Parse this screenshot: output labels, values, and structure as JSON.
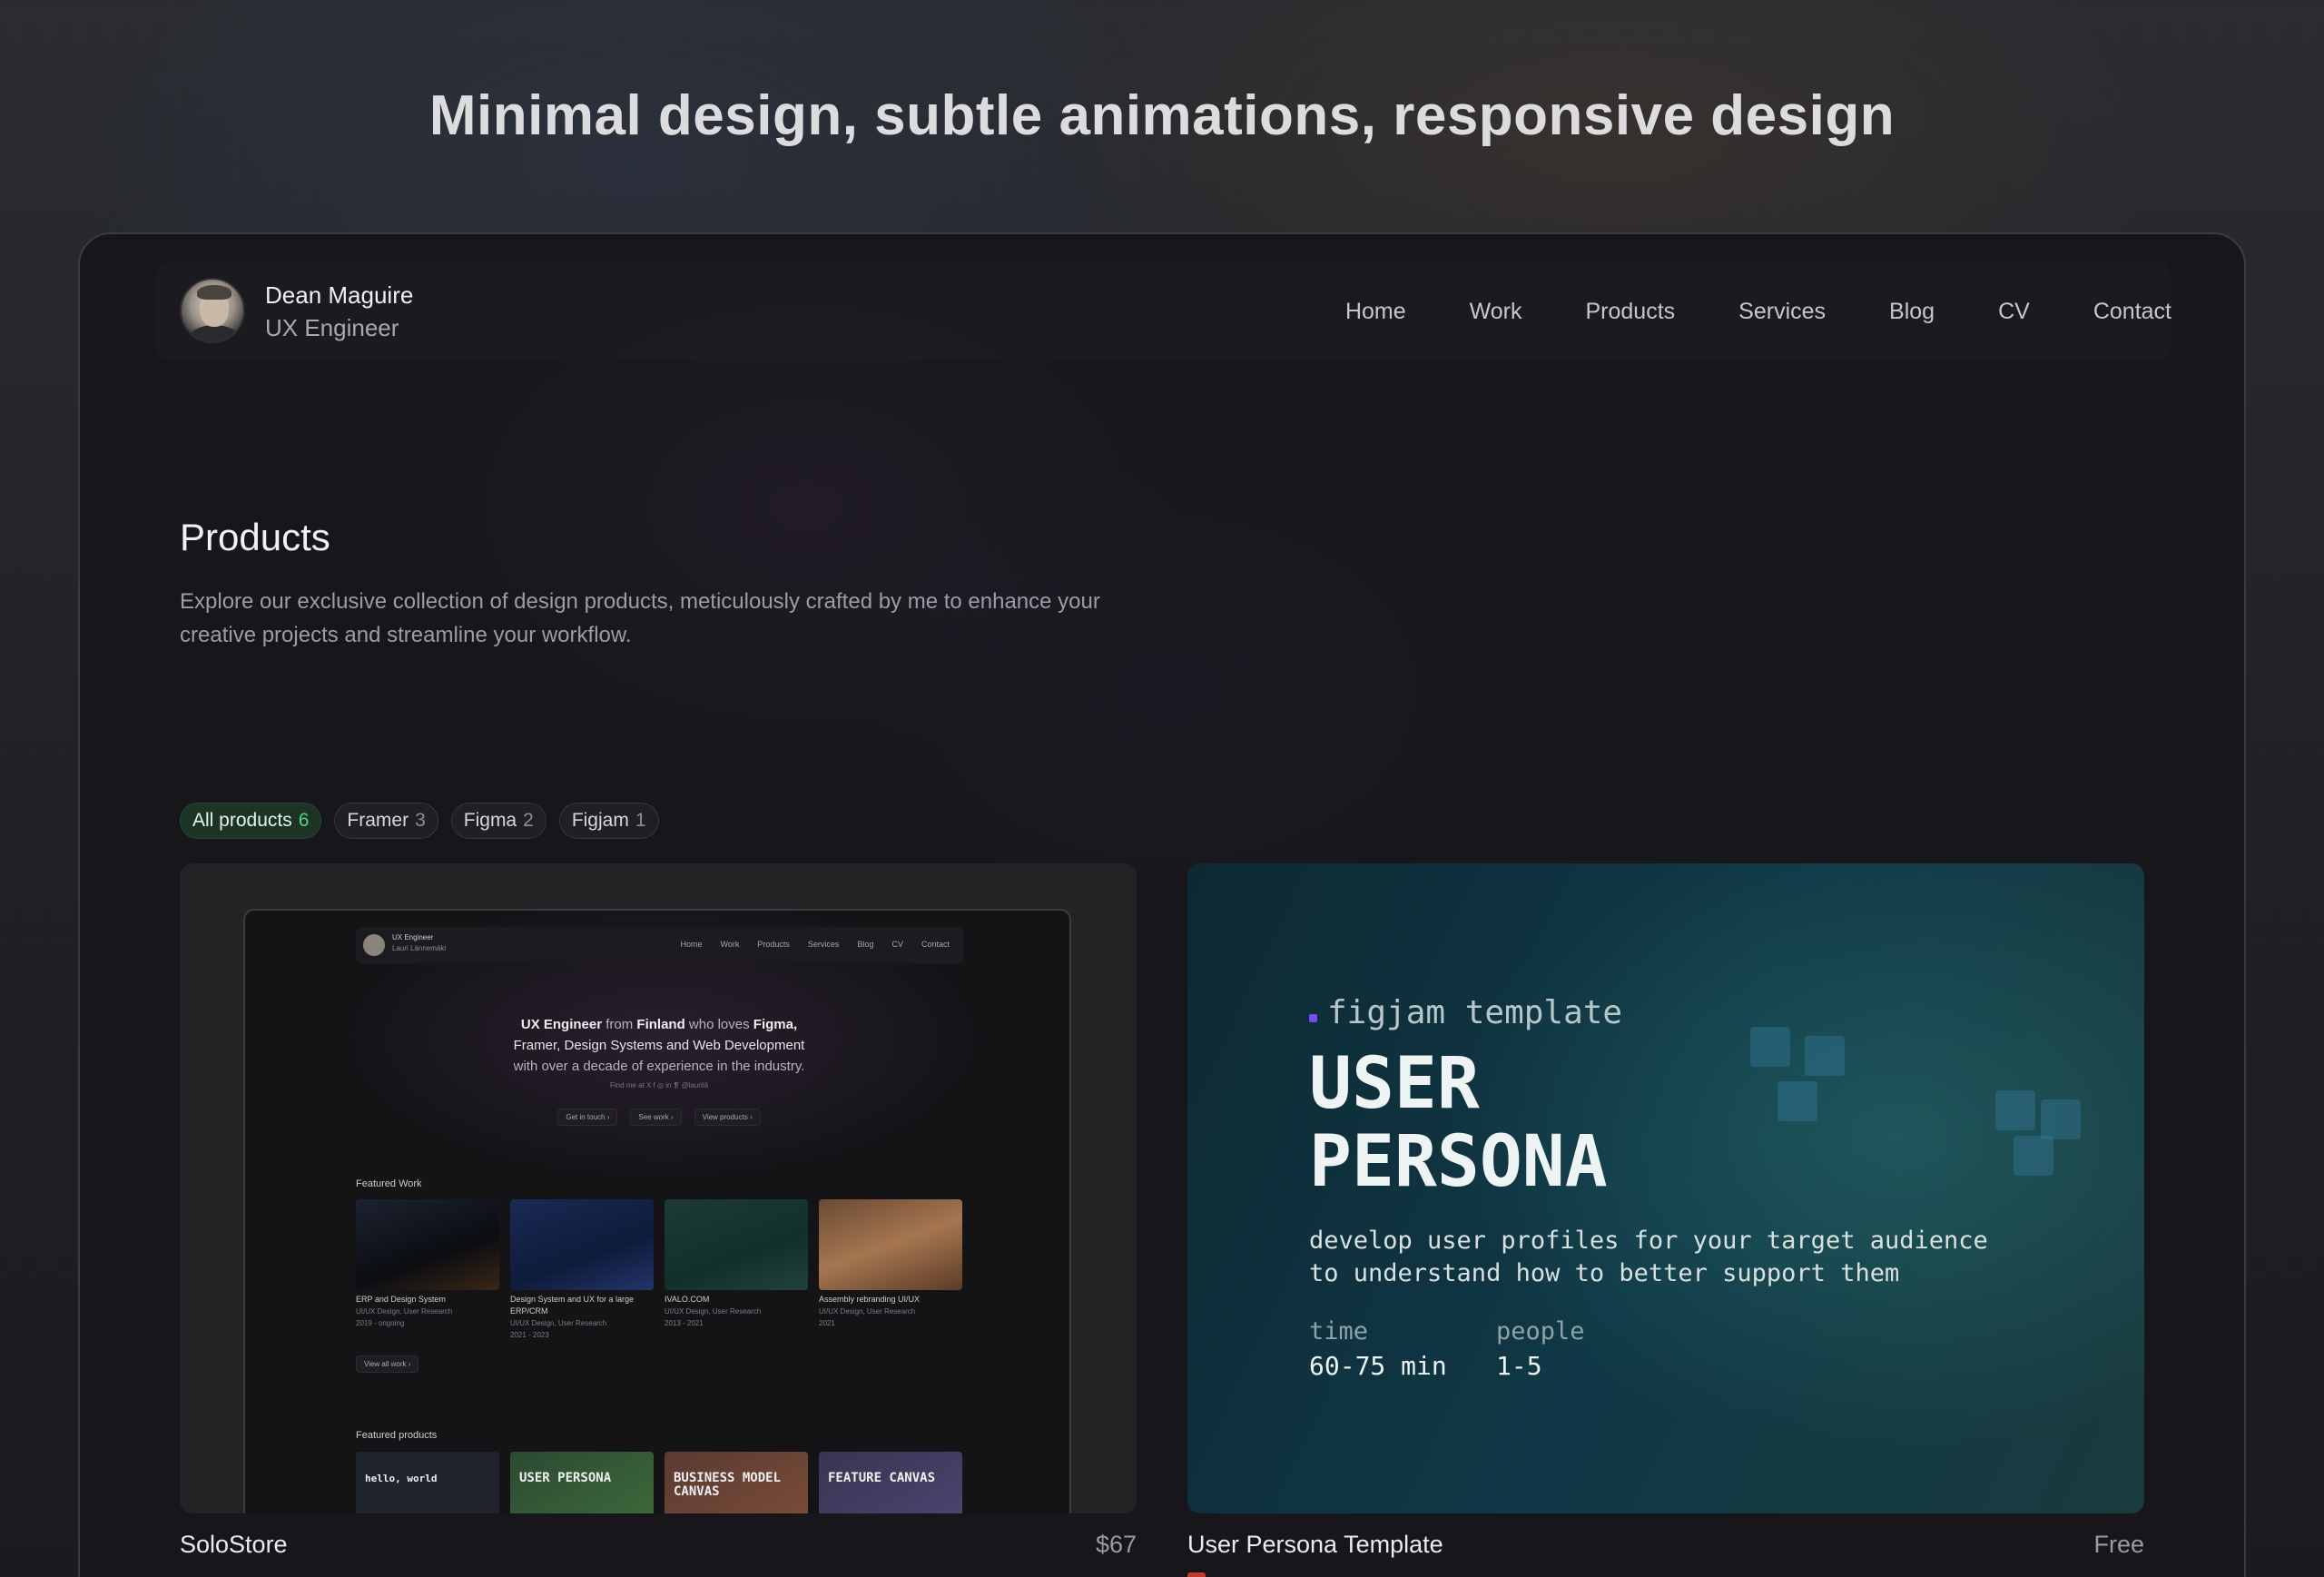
{
  "headline": "Minimal design, subtle animations, responsive design",
  "profile": {
    "name": "Dean Maguire",
    "role": "UX Engineer"
  },
  "nav": [
    "Home",
    "Work",
    "Products",
    "Services",
    "Blog",
    "CV",
    "Contact"
  ],
  "page": {
    "title": "Products",
    "description": "Explore our exclusive collection of design products, meticulously crafted by me to enhance your creative projects and streamline your workflow."
  },
  "filters": [
    {
      "label": "All products",
      "count": "6",
      "active": true
    },
    {
      "label": "Framer",
      "count": "3",
      "active": false
    },
    {
      "label": "Figma",
      "count": "2",
      "active": false
    },
    {
      "label": "Figjam",
      "count": "1",
      "active": false
    }
  ],
  "cards": [
    {
      "title": "SoloStore",
      "price": "$67"
    },
    {
      "title": "User Persona Template",
      "price": "Free"
    }
  ],
  "mini": {
    "nav_name": "UX Engineer",
    "nav_role": "Lauri Lännemäki",
    "nav_links": [
      "Home",
      "Work",
      "Products",
      "Services",
      "Blog",
      "CV",
      "Contact"
    ],
    "hero_line1_a": "UX Engineer",
    "hero_line1_b": " from ",
    "hero_line1_c": "Finland",
    "hero_line1_d": " who loves ",
    "hero_line1_e": "Figma,",
    "hero_line2": "Framer, Design Systems and Web Development",
    "hero_line3": "with over a decade of experience in the industry.",
    "social": "Find me at  X  f  ◎  in  ❡  @laurilä",
    "buttons": [
      "Get in touch ›",
      "See work ›",
      "View products ›"
    ],
    "featured_work": "Featured Work",
    "works": [
      {
        "title": "ERP and Design System",
        "sub": "UI/UX Design, User Research",
        "year": "2019 - ongoing"
      },
      {
        "title": "Design System and UX for a large ERP/CRM",
        "sub": "UI/UX Design, User Research",
        "year": "2021 - 2023"
      },
      {
        "title": "IVALO.COM",
        "sub": "UI/UX Design, User Research",
        "year": "2013 - 2021"
      },
      {
        "title": "Assembly rebranding UI/UX",
        "sub": "UI/UX Design, User Research",
        "year": "2021"
      }
    ],
    "view_all": "View all work ›",
    "featured_products": "Featured products",
    "products": [
      "hello, world",
      "USER PERSONA",
      "BUSINESS MODEL CANVAS",
      "FEATURE CANVAS"
    ]
  },
  "persona": {
    "tag": "figjam template",
    "heading_line1": "USER",
    "heading_line2": "PERSONA",
    "desc_line1": "develop user profiles for your target audience",
    "desc_line2": "to understand how to better support them",
    "time_label": "time",
    "time_value": "60-75 min",
    "people_label": "people",
    "people_value": "1-5"
  },
  "colors": {
    "accent_green": "#4fd28a",
    "tag_purple": "#7a4cf0"
  }
}
